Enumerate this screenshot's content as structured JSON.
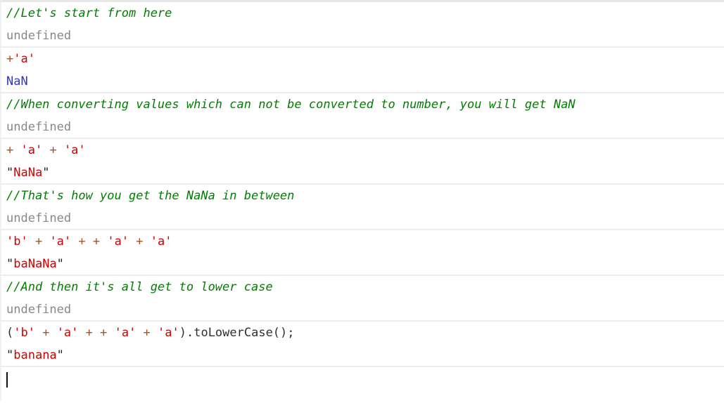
{
  "app": {
    "name": "javascript-console",
    "background_color": "#ffffff",
    "separator_color": "#ededed"
  },
  "colors": {
    "comment": "#008000",
    "undefined": "#888888",
    "number": "#3333cc",
    "string": "#d40000",
    "quote": "#222222",
    "operator": "#b1501a",
    "plain": "#303030",
    "caret": "#111111"
  },
  "console": {
    "groups": [
      {
        "input": {
          "name": "comment-start",
          "tokens": [
            {
              "type": "comment",
              "text": "//Let's start from here"
            }
          ]
        },
        "output": {
          "name": "result-undefined",
          "tokens": [
            {
              "type": "undefined",
              "text": "undefined"
            }
          ]
        }
      },
      {
        "input": {
          "name": "expression-unary-plus-a",
          "tokens": [
            {
              "type": "operator",
              "text": "+"
            },
            {
              "type": "string",
              "text": "'a'"
            }
          ]
        },
        "output": {
          "name": "result-nan",
          "tokens": [
            {
              "type": "number",
              "text": "NaN"
            }
          ]
        }
      },
      {
        "input": {
          "name": "comment-nan-explanation",
          "tokens": [
            {
              "type": "comment",
              "text": "//When converting values which can not be converted to number, you will get NaN"
            }
          ]
        },
        "output": {
          "name": "result-undefined",
          "tokens": [
            {
              "type": "undefined",
              "text": "undefined"
            }
          ]
        }
      },
      {
        "input": {
          "name": "expression-plus-a-plus-a",
          "tokens": [
            {
              "type": "operator",
              "text": "+ "
            },
            {
              "type": "string",
              "text": "'a'"
            },
            {
              "type": "operator",
              "text": " + "
            },
            {
              "type": "string",
              "text": "'a'"
            }
          ]
        },
        "output": {
          "name": "result-nana",
          "tokens": [
            {
              "type": "quote",
              "text": "\""
            },
            {
              "type": "string",
              "text": "NaNa"
            },
            {
              "type": "quote",
              "text": "\""
            }
          ]
        }
      },
      {
        "input": {
          "name": "comment-nana-in-between",
          "tokens": [
            {
              "type": "comment",
              "text": "//That's how you get the NaNa in between"
            }
          ]
        },
        "output": {
          "name": "result-undefined",
          "tokens": [
            {
              "type": "undefined",
              "text": "undefined"
            }
          ]
        }
      },
      {
        "input": {
          "name": "expression-banana-uppercase",
          "tokens": [
            {
              "type": "string",
              "text": "'b'"
            },
            {
              "type": "operator",
              "text": " + "
            },
            {
              "type": "string",
              "text": "'a'"
            },
            {
              "type": "operator",
              "text": " + + "
            },
            {
              "type": "string",
              "text": "'a'"
            },
            {
              "type": "operator",
              "text": " + "
            },
            {
              "type": "string",
              "text": "'a'"
            }
          ]
        },
        "output": {
          "name": "result-banana-mixed-case",
          "tokens": [
            {
              "type": "quote",
              "text": "\""
            },
            {
              "type": "string",
              "text": "baNaNa"
            },
            {
              "type": "quote",
              "text": "\""
            }
          ]
        }
      },
      {
        "input": {
          "name": "comment-lower-case",
          "tokens": [
            {
              "type": "comment",
              "text": "//And then it's all get to lower case"
            }
          ]
        },
        "output": {
          "name": "result-undefined",
          "tokens": [
            {
              "type": "undefined",
              "text": "undefined"
            }
          ]
        }
      },
      {
        "input": {
          "name": "expression-banana-tolowercase",
          "tokens": [
            {
              "type": "plain",
              "text": "("
            },
            {
              "type": "string",
              "text": "'b'"
            },
            {
              "type": "operator",
              "text": " + "
            },
            {
              "type": "string",
              "text": "'a'"
            },
            {
              "type": "operator",
              "text": " + + "
            },
            {
              "type": "string",
              "text": "'a'"
            },
            {
              "type": "operator",
              "text": " + "
            },
            {
              "type": "string",
              "text": "'a'"
            },
            {
              "type": "plain",
              "text": ").toLowerCase();"
            }
          ]
        },
        "output": {
          "name": "result-banana",
          "tokens": [
            {
              "type": "quote",
              "text": "\""
            },
            {
              "type": "string",
              "text": "banana"
            },
            {
              "type": "quote",
              "text": "\""
            }
          ]
        }
      }
    ],
    "prompt": {
      "name": "console-prompt",
      "value": "",
      "caret_visible": true
    }
  }
}
